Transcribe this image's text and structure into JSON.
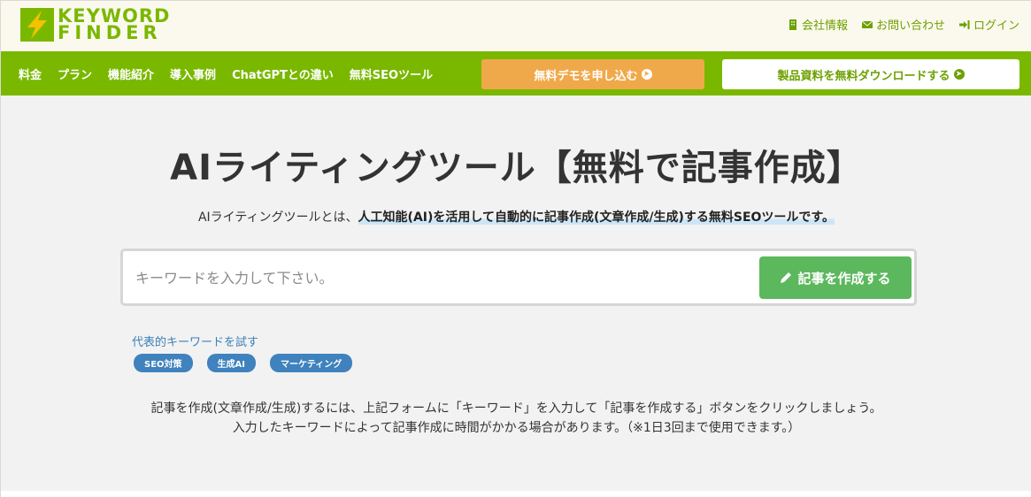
{
  "brand": {
    "line1": "KEYWORD",
    "line2": "FINDER",
    "color": "#7ab800"
  },
  "top_links": [
    {
      "label": "会社情報",
      "icon": "building-icon"
    },
    {
      "label": "お問い合わせ",
      "icon": "envelope-icon"
    },
    {
      "label": "ログイン",
      "icon": "login-icon"
    }
  ],
  "nav": {
    "items": [
      "料金",
      "プラン",
      "機能紹介",
      "導入事例",
      "ChatGPTとの違い",
      "無料SEOツール"
    ],
    "demo_button": "無料デモを申し込む",
    "download_button": "製品資料を無料ダウンロードする"
  },
  "hero": {
    "title": "AIライティングツール【無料で記事作成】",
    "lead_plain": "AIライティングツールとは、",
    "lead_highlight": "人工知能(AI)を活用して自動的に記事作成(文章作成/生成)する無料SEOツールです。"
  },
  "search": {
    "placeholder": "キーワードを入力して下さい。",
    "value": "",
    "submit_label": "記事を作成する"
  },
  "sample_keywords": {
    "label": "代表的キーワードを試す",
    "tags": [
      "SEO対策",
      "生成AI",
      "マーケティング"
    ]
  },
  "description": {
    "line1": "記事を作成(文章作成/生成)するには、上記フォームに「キーワード」を入力して「記事を作成する」ボタンをクリックしましょう。",
    "line2": "入力したキーワードによって記事作成に時間がかかる場合があります。（※1日3回まで使用できます。）"
  },
  "colors": {
    "accent_green": "#7ab800",
    "demo_orange": "#f0a94a",
    "create_green": "#5cb85c",
    "tag_blue": "#3f82bd"
  }
}
